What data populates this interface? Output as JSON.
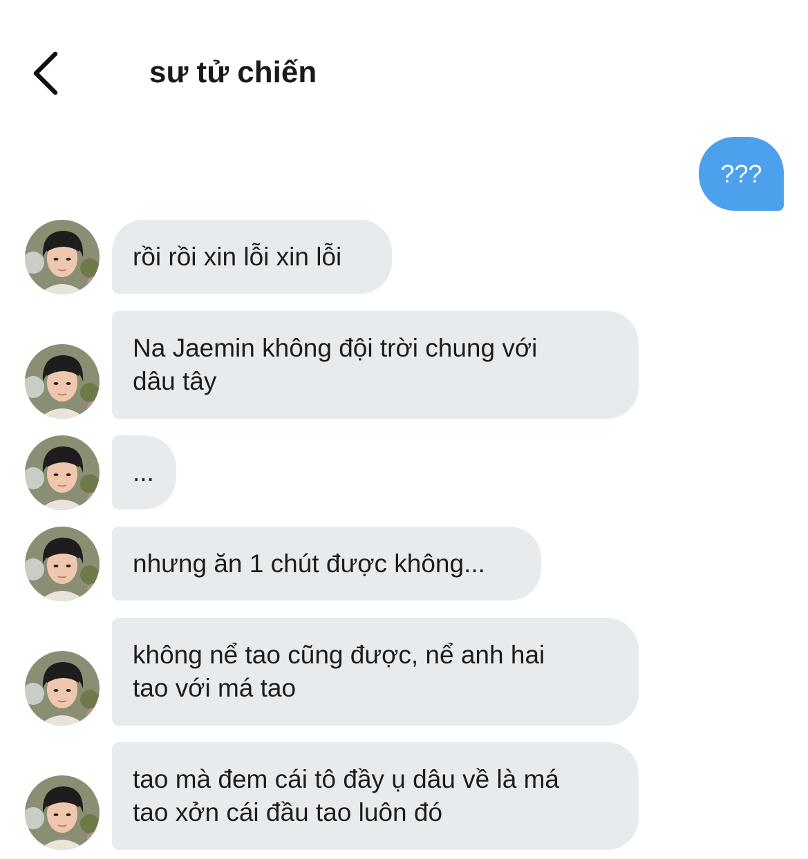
{
  "header": {
    "title": "sư tử chiến",
    "back_icon": "chevron-left-icon"
  },
  "messages": [
    {
      "sender": "me",
      "text": "???"
    },
    {
      "sender": "them",
      "lines": [
        "rồi rồi xin lỗi xin lỗi"
      ]
    },
    {
      "sender": "them",
      "lines": [
        "Na Jaemin không đội trời chung với",
        "dâu tây"
      ]
    },
    {
      "sender": "them",
      "lines": [
        "..."
      ]
    },
    {
      "sender": "them",
      "lines": [
        "nhưng ăn 1 chút được không..."
      ]
    },
    {
      "sender": "them",
      "lines": [
        "không nể tao cũng được, nể anh hai",
        "tao với má tao"
      ]
    },
    {
      "sender": "them",
      "lines": [
        "tao mà đem cái tô đầy ụ dâu về là má",
        "tao xởn cái đầu tao luôn đó"
      ]
    }
  ],
  "colors": {
    "outgoing_bubble": "#4da0ec",
    "incoming_bubble": "#e7ebee"
  },
  "avatar_icon": "avatar-photo"
}
